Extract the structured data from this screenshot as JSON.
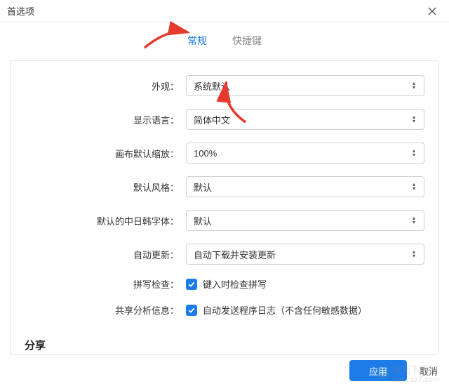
{
  "window": {
    "title": "首选项"
  },
  "tabs": {
    "general": "常规",
    "shortcuts": "快捷键"
  },
  "labels": {
    "appearance": "外观：",
    "displayLanguage": "显示语言：",
    "canvasDefaultZoom": "画布默认缩放：",
    "defaultStyle": "默认风格：",
    "defaultCJKFont": "默认的中日韩字体：",
    "autoUpdate": "自动更新：",
    "spellCheck": "拼写检查：",
    "shareAnalytics": "共享分析信息："
  },
  "values": {
    "appearance": "系统默认",
    "displayLanguage": "简体中文",
    "canvasDefaultZoom": "100%",
    "defaultStyle": "默认",
    "defaultCJKFont": "默认",
    "autoUpdate": "自动下载并安装更新",
    "spellCheckLabel": "键入时检查拼写",
    "shareAnalyticsLabel": "自动发送程序日志（不含任何敏感数据）"
  },
  "section": {
    "share": "分享"
  },
  "footer": {
    "apply": "应用",
    "cancel": "取消"
  },
  "watermark": {
    "name": "极光下载站",
    "url": "www.xz7.com"
  }
}
